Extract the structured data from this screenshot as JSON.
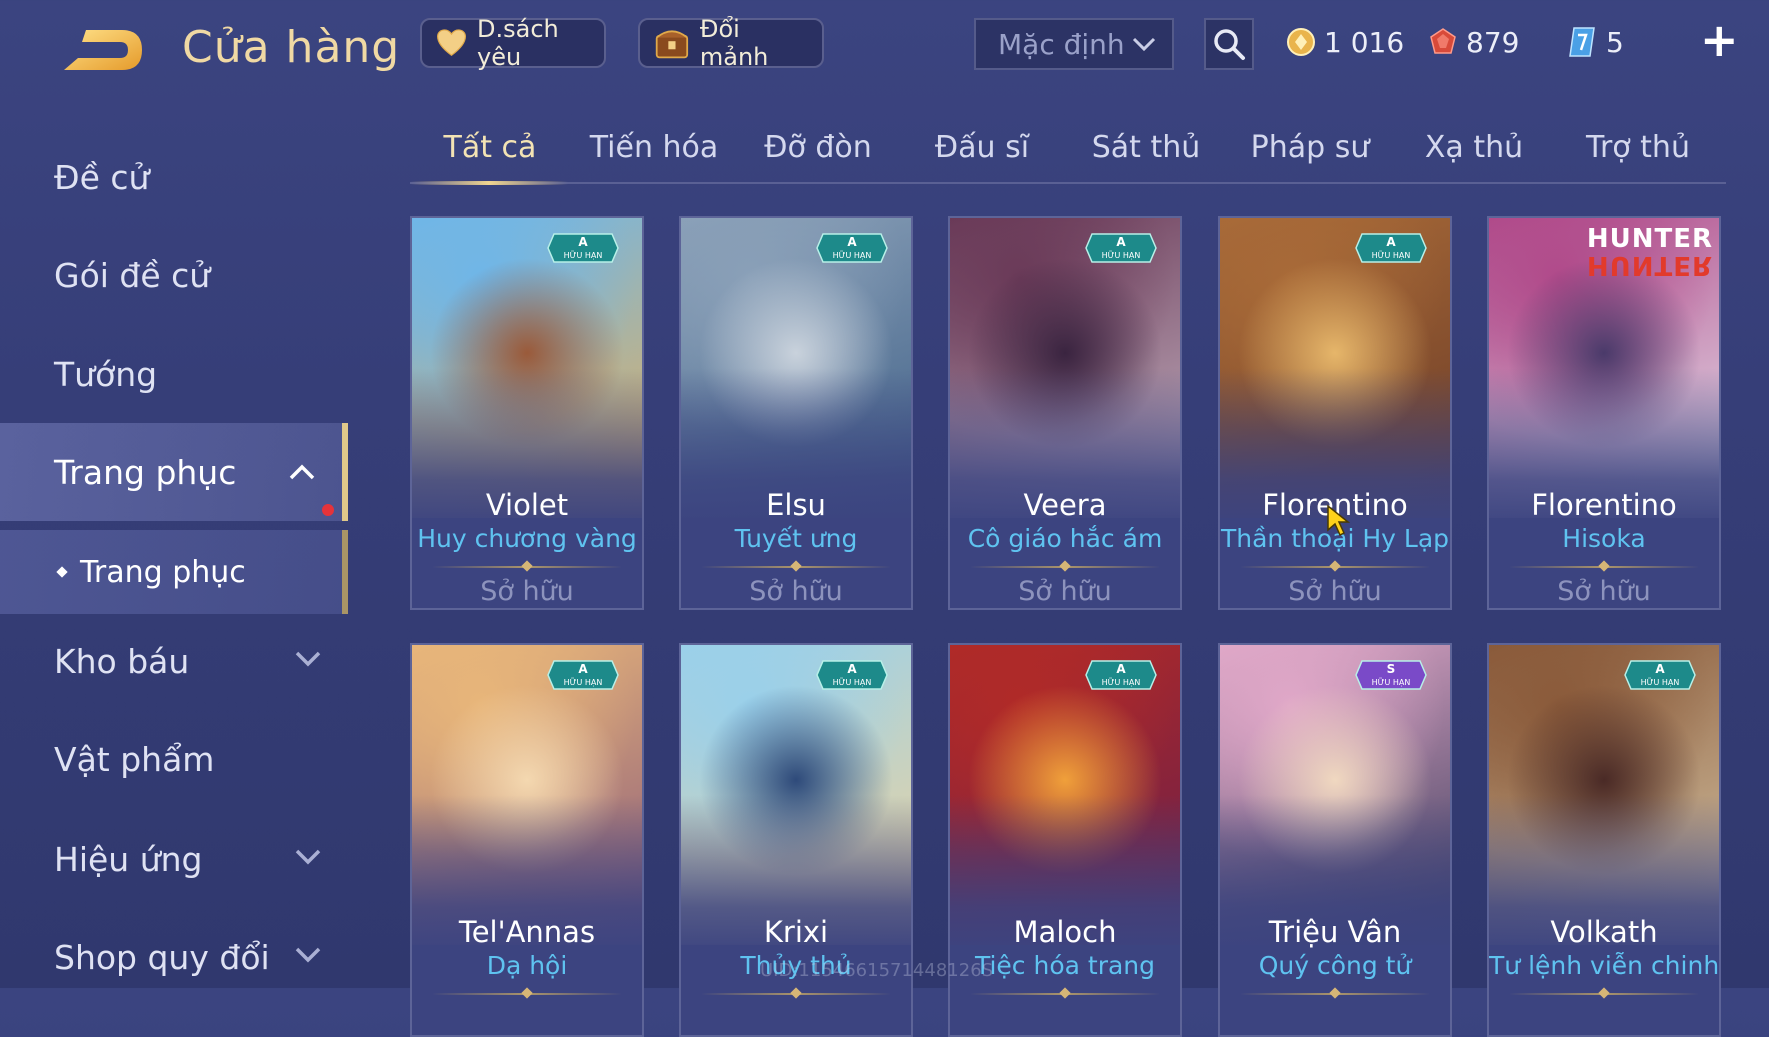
{
  "header": {
    "title": "Cửa hàng",
    "back_icon": "back-arrow-icon",
    "favorites_label": "D.sách yêu",
    "exchange_label": "Đổi mảnh",
    "sort_value": "Mặc định",
    "currencies": [
      {
        "icon": "gold-coin-icon",
        "value": "1 016"
      },
      {
        "icon": "red-voucher-icon",
        "value": "879"
      },
      {
        "icon": "ticket-icon",
        "value": "5"
      }
    ],
    "add_label": "+"
  },
  "sidebar": {
    "items": [
      {
        "label": "Đề cử"
      },
      {
        "label": "Gói đề cử"
      },
      {
        "label": "Tướng"
      },
      {
        "label": "Trang phục"
      },
      {
        "label": "Kho báu"
      },
      {
        "label": "Vật phẩm"
      },
      {
        "label": "Hiệu ứng"
      },
      {
        "label": "Shop quy đổi"
      }
    ],
    "sub_item": "Trang phục"
  },
  "tabs": [
    "Tất cả",
    "Tiến hóa",
    "Đỡ đòn",
    "Đấu sĩ",
    "Sát thủ",
    "Pháp sư",
    "Xạ thủ",
    "Trợ thủ"
  ],
  "cards": [
    {
      "hero": "Violet",
      "skin": "Huy chương vàng",
      "status": "Sở hữu",
      "tier": "A",
      "tag": "HỮU HẠN",
      "art_colors": [
        "#6fb6e8",
        "#e7b05a",
        "#9a5a3a"
      ]
    },
    {
      "hero": "Elsu",
      "skin": "Tuyết ưng",
      "status": "Sở hữu",
      "tier": "A",
      "tag": "HỮU HẠN",
      "art_colors": [
        "#8aa0b8",
        "#3e5f86",
        "#c9d2dc"
      ]
    },
    {
      "hero": "Veera",
      "skin": "Cô giáo hắc ám",
      "status": "Sở hữu",
      "tier": "A",
      "tag": "HỮU HẠN",
      "art_colors": [
        "#6a3a58",
        "#c8b7c5",
        "#3a2440"
      ]
    },
    {
      "hero": "Florentino",
      "skin": "Thần thoại Hy Lạp",
      "status": "Sở hữu",
      "tier": "A",
      "tag": "HỮU HẠN",
      "art_colors": [
        "#a86a38",
        "#6a3a26",
        "#e6b66a"
      ]
    },
    {
      "hero": "Florentino",
      "skin": "Hisoka",
      "status": "Sở hữu",
      "brand": [
        "HUNTER",
        "HUNTER"
      ],
      "art_colors": [
        "#b04a8a",
        "#e8e8f0",
        "#4a3a6a"
      ]
    },
    {
      "hero": "Tel'Annas",
      "skin": "Dạ hội",
      "tier": "A",
      "tag": "HỮU HẠN",
      "art_colors": [
        "#e8b67a",
        "#8a5a7a",
        "#f4d8b0"
      ]
    },
    {
      "hero": "Krixi",
      "skin": "Thủy thủ",
      "tier": "A",
      "tag": "HỮU HẠN",
      "art_colors": [
        "#9ad0ea",
        "#f2d49a",
        "#2e4a7a"
      ]
    },
    {
      "hero": "Maloch",
      "skin": "Tiệc hóa trang",
      "tier": "A",
      "tag": "HỮU HẠN",
      "art_colors": [
        "#b02a28",
        "#6a1e4a",
        "#f0a03a"
      ]
    },
    {
      "hero": "Triệu Vân",
      "skin": "Quý công tử",
      "tier": "S",
      "tag": "HỮU HẠN",
      "art_colors": [
        "#e0a8c8",
        "#3a3a5a",
        "#f0d8c0"
      ]
    },
    {
      "hero": "Volkath",
      "skin": "Tư lệnh viễn chinh",
      "tier": "A",
      "tag": "HỮU HẠN",
      "art_colors": [
        "#8a5a3a",
        "#d8c8a8",
        "#4a2a26"
      ]
    }
  ],
  "watermark": "UID:1154661571448126S",
  "colors": {
    "accent_gold": "#f0d590",
    "skin_blue": "#5fc3f0",
    "badge_teal": "#1d8a8a",
    "badge_purple": "#7a4ac8",
    "notify_red": "#e5333a"
  }
}
